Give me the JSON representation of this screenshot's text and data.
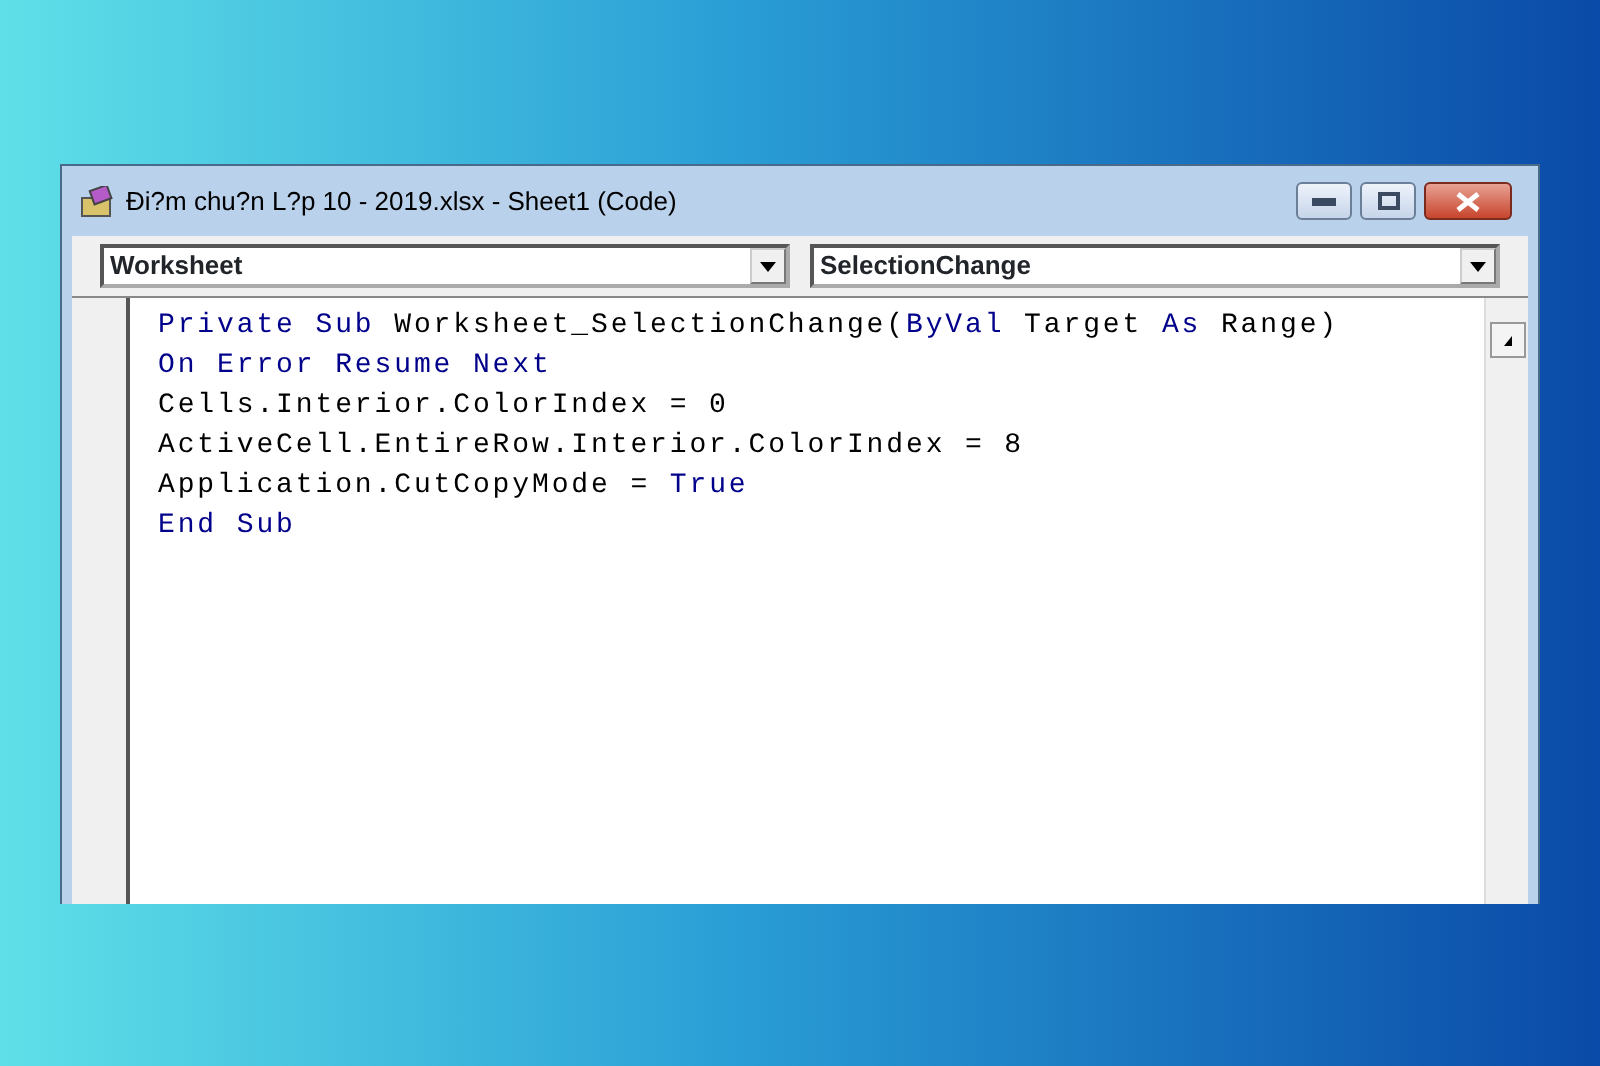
{
  "window": {
    "title": "Đi?m chu?n L?p 10 - 2019.xlsx - Sheet1 (Code)"
  },
  "object_dropdown": {
    "value": "Worksheet"
  },
  "procedure_dropdown": {
    "value": "SelectionChange"
  },
  "code_lines": [
    [
      {
        "text": "Private Sub",
        "keyword": true
      },
      {
        "text": " Worksheet_SelectionChange(",
        "keyword": false
      },
      {
        "text": "ByVal",
        "keyword": true
      },
      {
        "text": " Target ",
        "keyword": false
      },
      {
        "text": "As",
        "keyword": true
      },
      {
        "text": " Range)",
        "keyword": false
      }
    ],
    [
      {
        "text": "On Error Resume Next",
        "keyword": true
      }
    ],
    [
      {
        "text": "Cells.Interior.ColorIndex = 0",
        "keyword": false
      }
    ],
    [
      {
        "text": "ActiveCell.EntireRow.Interior.ColorIndex = 8",
        "keyword": false
      }
    ],
    [
      {
        "text": "Application.CutCopyMode = ",
        "keyword": false
      },
      {
        "text": "True",
        "keyword": true
      }
    ],
    [
      {
        "text": "End Sub",
        "keyword": true
      }
    ]
  ]
}
